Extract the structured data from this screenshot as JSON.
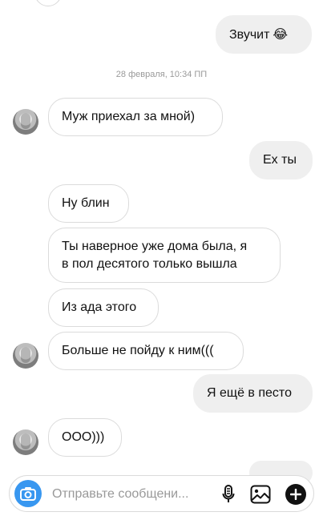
{
  "thread": {
    "timestamp": "28 февраля, 10:34 ПП",
    "messages": [
      {
        "side": "out",
        "text": "Звучит",
        "emoji": "😂"
      },
      {
        "side": "in",
        "text": "Муж приехал за мной)"
      },
      {
        "side": "out",
        "text": "Ех ты"
      },
      {
        "side": "in",
        "text": "Ну блин"
      },
      {
        "side": "in",
        "text_line1": "Ты наверное уже дома была, я",
        "text_line2": "в пол десятого только вышла"
      },
      {
        "side": "in",
        "text": "Из ада этого"
      },
      {
        "side": "in",
        "text": "Больше не пойду к ним((("
      },
      {
        "side": "out",
        "text": "Я ещё в песто"
      },
      {
        "side": "in",
        "text": "ООО)))"
      }
    ]
  },
  "composer": {
    "placeholder": "Отправьте сообщени...",
    "camera_icon": "camera-icon",
    "mic_icon": "microphone-icon",
    "gallery_icon": "image-icon",
    "plus_icon": "plus-icon"
  },
  "colors": {
    "accent": "#3897f0",
    "outgoing_bubble": "#efefef",
    "incoming_border": "#dbdbdb"
  }
}
